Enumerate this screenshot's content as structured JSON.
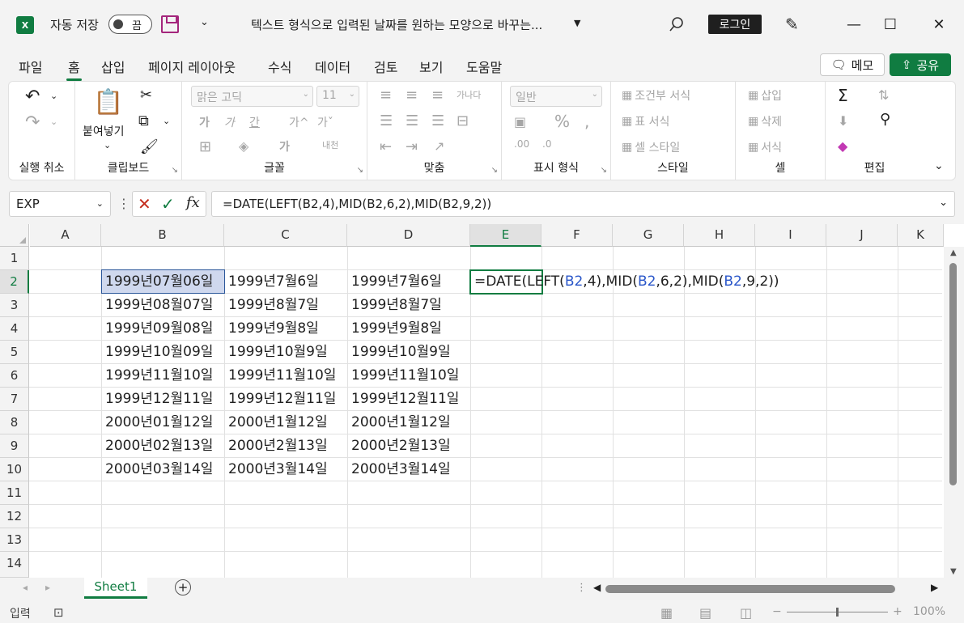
{
  "titlebar": {
    "app_logo": "X",
    "autosave_label": "자동 저장",
    "autosave_state": "끔",
    "document_title": "텍스트 형식으로 입력된 날짜를 원하는 모양으로 바꾸는...",
    "login_label": "로그인"
  },
  "menu": {
    "tabs": [
      "파일",
      "홈",
      "삽입",
      "페이지 레이아웃",
      "수식",
      "데이터",
      "검토",
      "보기",
      "도움말"
    ],
    "active_tab": "홈",
    "memo_label": "메모",
    "share_label": "공유",
    "accent_color": "#107c41"
  },
  "ribbon": {
    "undo_group_label": "실행 취소",
    "clipboard": {
      "paste_label": "붙여넣기",
      "group_label": "클립보드"
    },
    "font": {
      "font_name": "맑은 고딕",
      "font_size": "11",
      "group_label": "글꼴",
      "bold": "가",
      "italic": "가",
      "underline": "간",
      "grow": "가^",
      "shrink": "가ˇ",
      "wrap_label": "내천"
    },
    "alignment": {
      "group_label": "맞춤",
      "wrap_label": "가나다"
    },
    "number": {
      "format": "일반",
      "group_label": "표시 형식"
    },
    "styles": {
      "conditional": "조건부 서식",
      "table": "표 서식",
      "cell_style": "셀 스타일",
      "group_label": "스타일"
    },
    "cells": {
      "insert": "삽입",
      "delete": "삭제",
      "format": "서식",
      "group_label": "셀"
    },
    "editing": {
      "group_label": "편집"
    }
  },
  "formula_bar": {
    "name_box": "EXP",
    "formula": "=DATE(LEFT(B2,4),MID(B2,6,2),MID(B2,9,2))"
  },
  "grid": {
    "columns": [
      "A",
      "B",
      "C",
      "D",
      "E",
      "F",
      "G",
      "H",
      "I",
      "J",
      "K"
    ],
    "rows": [
      "1",
      "2",
      "3",
      "4",
      "5",
      "6",
      "7",
      "8",
      "9",
      "10",
      "11",
      "12",
      "13",
      "14"
    ],
    "selected_column": "E",
    "selected_row": "2",
    "col_b": [
      "1999년07월06일",
      "1999년08월07일",
      "1999년09월08일",
      "1999년10월09일",
      "1999년11월10일",
      "1999년12월11일",
      "2000년01월12일",
      "2000년02월13일",
      "2000년03월14일"
    ],
    "col_c": [
      "1999년7월6일",
      "1999년8월7일",
      "1999년9월8일",
      "1999년10월9일",
      "1999년11월10일",
      "1999년12월11일",
      "2000년1월12일",
      "2000년2월13일",
      "2000년3월14일"
    ],
    "col_d": [
      "1999년7월6일",
      "1999년8월7일",
      "1999년9월8일",
      "1999년10월9일",
      "1999년11월10일",
      "1999년12월11일",
      "2000년1월12일",
      "2000년2월13일",
      "2000년3월14일"
    ],
    "e2_parts": [
      "=DATE(LEFT(",
      "B2",
      ",4),MID(",
      "B2",
      ",6,2),MID(",
      "B2",
      ",9,2))"
    ]
  },
  "sheets": {
    "tabs": [
      "Sheet1"
    ]
  },
  "status": {
    "mode": "입력",
    "zoom": "100%"
  }
}
